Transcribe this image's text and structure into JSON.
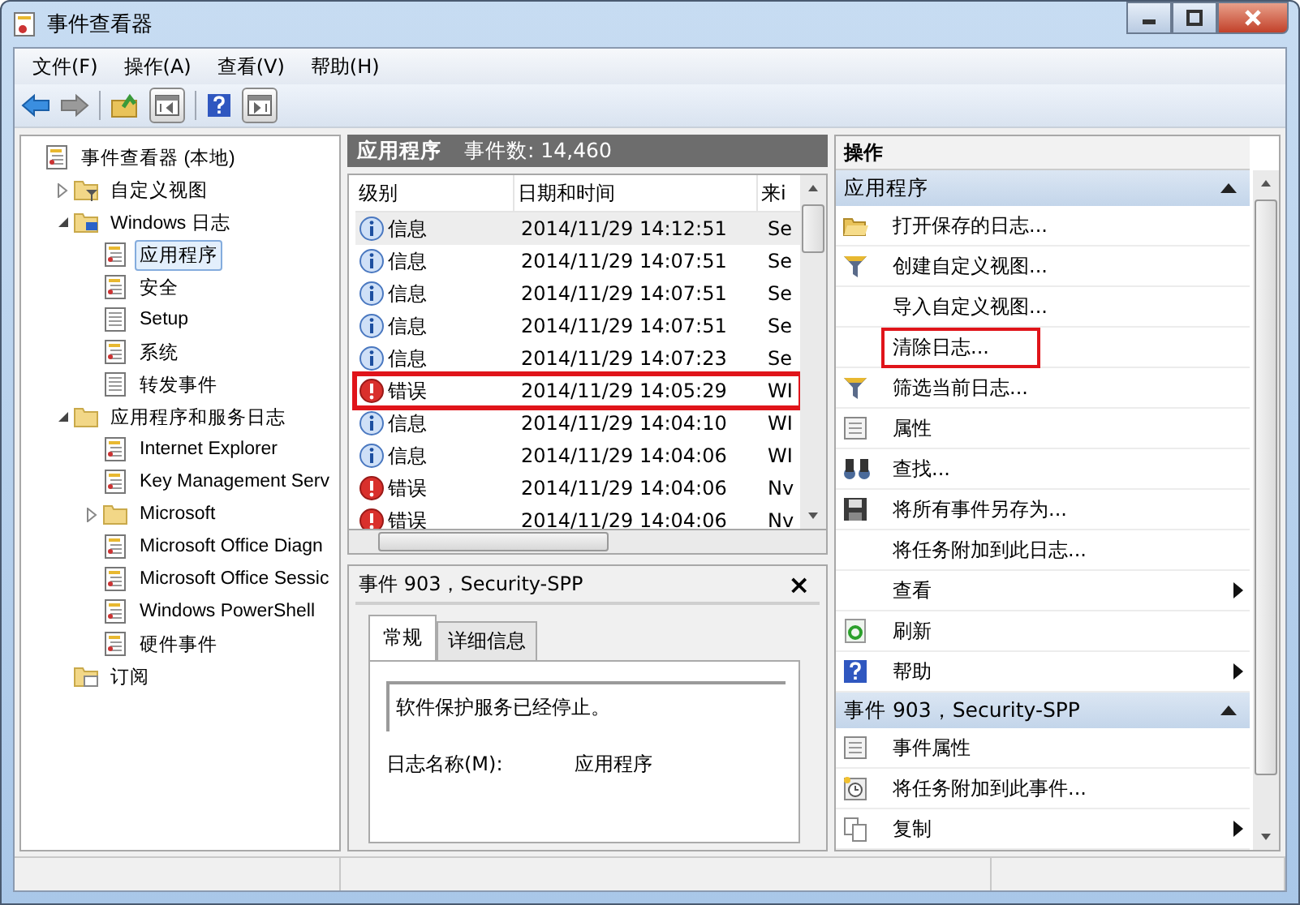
{
  "window": {
    "title": "事件查看器"
  },
  "menu": [
    "文件(F)",
    "操作(A)",
    "查看(V)",
    "帮助(H)"
  ],
  "tree": [
    {
      "label": "事件查看器 (本地)",
      "kind": "log",
      "selected": false,
      "children": [
        {
          "label": "自定义视图",
          "kind": "filterfolder",
          "selected": false,
          "expanded": false
        },
        {
          "label": "Windows 日志",
          "kind": "pcfolder",
          "selected": false,
          "expanded": true,
          "children": [
            {
              "label": "应用程序",
              "kind": "log",
              "selected": true
            },
            {
              "label": "安全",
              "kind": "log",
              "selected": false
            },
            {
              "label": "Setup",
              "kind": "plain",
              "selected": false
            },
            {
              "label": "系统",
              "kind": "log",
              "selected": false
            },
            {
              "label": "转发事件",
              "kind": "plain",
              "selected": false
            }
          ]
        },
        {
          "label": "应用程序和服务日志",
          "kind": "folder",
          "selected": false,
          "expanded": true,
          "children": [
            {
              "label": "Internet Explorer",
              "kind": "log",
              "selected": false
            },
            {
              "label": "Key Management Serv",
              "kind": "log",
              "selected": false
            },
            {
              "label": "Microsoft",
              "kind": "folder",
              "selected": false,
              "expanded": false
            },
            {
              "label": "Microsoft Office Diagn",
              "kind": "log",
              "selected": false
            },
            {
              "label": "Microsoft Office Sessic",
              "kind": "log",
              "selected": false
            },
            {
              "label": "Windows PowerShell",
              "kind": "log",
              "selected": false
            },
            {
              "label": "硬件事件",
              "kind": "log",
              "selected": false
            }
          ]
        },
        {
          "label": "订阅",
          "kind": "subfolder",
          "selected": false
        }
      ]
    }
  ],
  "events": {
    "title": "应用程序",
    "count": "事件数: 14,460",
    "columns": [
      "级别",
      "日期和时间",
      "来i"
    ],
    "rows": [
      {
        "kind": "info",
        "level": "信息",
        "datetime": "2014/11/29 14:12:51",
        "source": "Se",
        "selected": true,
        "highlight": false
      },
      {
        "kind": "info",
        "level": "信息",
        "datetime": "2014/11/29 14:07:51",
        "source": "Se",
        "selected": false,
        "highlight": false
      },
      {
        "kind": "info",
        "level": "信息",
        "datetime": "2014/11/29 14:07:51",
        "source": "Se",
        "selected": false,
        "highlight": false
      },
      {
        "kind": "info",
        "level": "信息",
        "datetime": "2014/11/29 14:07:51",
        "source": "Se",
        "selected": false,
        "highlight": false
      },
      {
        "kind": "info",
        "level": "信息",
        "datetime": "2014/11/29 14:07:23",
        "source": "Se",
        "selected": false,
        "highlight": false
      },
      {
        "kind": "error",
        "level": "错误",
        "datetime": "2014/11/29 14:05:29",
        "source": "WI",
        "selected": false,
        "highlight": true
      },
      {
        "kind": "info",
        "level": "信息",
        "datetime": "2014/11/29 14:04:10",
        "source": "WI",
        "selected": false,
        "highlight": false
      },
      {
        "kind": "info",
        "level": "信息",
        "datetime": "2014/11/29 14:04:06",
        "source": "WI",
        "selected": false,
        "highlight": false
      },
      {
        "kind": "error",
        "level": "错误",
        "datetime": "2014/11/29 14:04:06",
        "source": "Nv",
        "selected": false,
        "highlight": false
      },
      {
        "kind": "error",
        "level": "错误",
        "datetime": "2014/11/29 14:04:06",
        "source": "Nv",
        "selected": false,
        "highlight": false
      }
    ]
  },
  "detail": {
    "title": "事件 903，Security-SPP",
    "close": "×",
    "tabs": [
      {
        "label": "常规",
        "selected": true
      },
      {
        "label": "详细信息",
        "selected": false
      }
    ],
    "message": "软件保护服务已经停止。",
    "field_label": "日志名称(M):",
    "field_value": "应用程序"
  },
  "actions": {
    "title": "操作",
    "sections": [
      {
        "title": "应用程序",
        "items": [
          {
            "label": "打开保存的日志...",
            "kind": "openfolder",
            "submenu": false,
            "highlight": false
          },
          {
            "label": "创建自定义视图...",
            "kind": "filter",
            "submenu": false,
            "highlight": false
          },
          {
            "label": "导入自定义视图...",
            "kind": "plain",
            "submenu": false,
            "highlight": false
          },
          {
            "label": "清除日志...",
            "kind": "plain",
            "submenu": false,
            "highlight": true
          },
          {
            "label": "筛选当前日志...",
            "kind": "filter",
            "submenu": false,
            "highlight": false
          },
          {
            "label": "属性",
            "kind": "props",
            "submenu": false,
            "highlight": false
          },
          {
            "label": "查找...",
            "kind": "binoculars",
            "submenu": false,
            "highlight": false
          },
          {
            "label": "将所有事件另存为...",
            "kind": "save",
            "submenu": false,
            "highlight": false
          },
          {
            "label": "将任务附加到此日志...",
            "kind": "plain",
            "submenu": false,
            "highlight": false
          },
          {
            "label": "查看",
            "kind": "plain",
            "submenu": true,
            "highlight": false
          },
          {
            "label": "刷新",
            "kind": "refresh",
            "submenu": false,
            "highlight": false
          },
          {
            "label": "帮助",
            "kind": "help",
            "submenu": true,
            "highlight": false
          }
        ]
      },
      {
        "title": "事件 903，Security-SPP",
        "items": [
          {
            "label": "事件属性",
            "kind": "props",
            "submenu": false,
            "highlight": false
          },
          {
            "label": "将任务附加到此事件...",
            "kind": "task",
            "submenu": false,
            "highlight": false
          },
          {
            "label": "复制",
            "kind": "copy",
            "submenu": true,
            "highlight": false
          }
        ]
      }
    ]
  }
}
